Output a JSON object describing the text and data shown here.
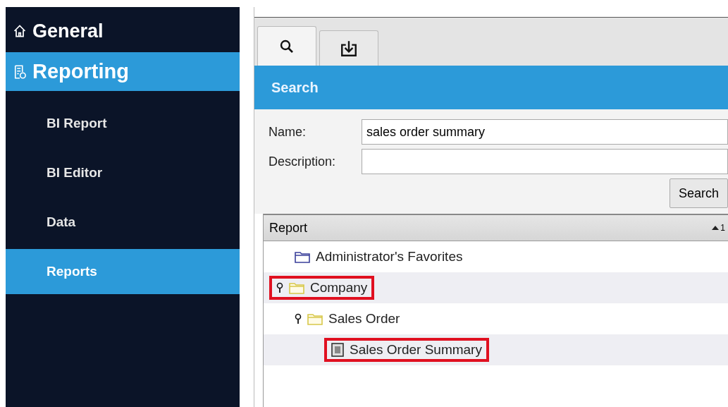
{
  "sidebar": {
    "sections": [
      {
        "label": "General",
        "kind": "home",
        "selected": false
      },
      {
        "label": "Reporting",
        "kind": "report",
        "selected": true,
        "children": [
          {
            "label": "BI Report",
            "selected": false
          },
          {
            "label": "BI Editor",
            "selected": false
          },
          {
            "label": "Data",
            "selected": false
          },
          {
            "label": "Reports",
            "selected": true
          }
        ]
      }
    ]
  },
  "tabs": [
    {
      "kind": "search",
      "selected": true
    },
    {
      "kind": "import",
      "selected": false
    }
  ],
  "panel": {
    "title": "Search",
    "fields": [
      {
        "label": "Name:",
        "value": "sales order summary"
      },
      {
        "label": "Description:"
      }
    ],
    "search_button": "Search",
    "tree": {
      "column": "Report",
      "sort_order": "1",
      "items": [
        {
          "label": "Administrator's Favorites",
          "kind": "favorites",
          "highlighted": false
        },
        {
          "label": "Company",
          "kind": "folder",
          "highlighted": true,
          "children": [
            {
              "label": "Sales Order",
              "kind": "folder",
              "highlighted": false,
              "children": [
                {
                  "label": "Sales Order Summary",
                  "kind": "report",
                  "highlighted": true
                }
              ]
            }
          ]
        }
      ]
    }
  }
}
